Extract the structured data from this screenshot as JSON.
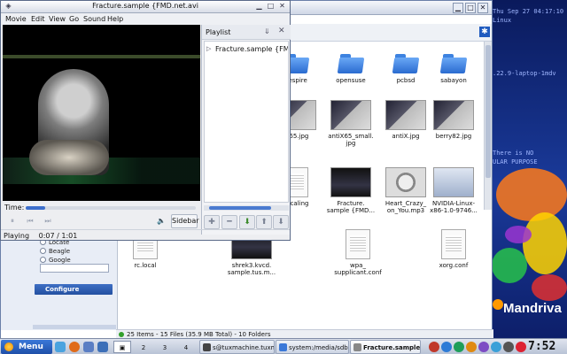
{
  "desktop": {
    "info_text": "Thu Sep 27 04:17:10\nLinux\n\n\n\n\n\n.22.9-laptop-1mdv\n\n\n\n\n\n\n\n\nThere is NO\nULAR PURPOSE",
    "logo_text": "Mandriva"
  },
  "file_manager": {
    "files": [
      {
        "name": "eespire",
        "kind": "folder"
      },
      {
        "name": "opensuse",
        "kind": "folder"
      },
      {
        "name": "pcbsd",
        "kind": "folder"
      },
      {
        "name": "sabayon",
        "kind": "folder"
      },
      {
        "name": "iX65.jpg",
        "kind": "image"
      },
      {
        "name": "antiX65_small.\njpg",
        "kind": "image"
      },
      {
        "name": "antiX.jpg",
        "kind": "image"
      },
      {
        "name": "berry82.jpg",
        "kind": "image"
      },
      {
        "name": "uscaling",
        "kind": "doc"
      },
      {
        "name": "Fracture.\nsample {FMD...",
        "kind": "video"
      },
      {
        "name": "Heart_Crazy_\non_You.mp3",
        "kind": "audio"
      },
      {
        "name": "NVIDIA-Linux-\nx86-1.0-9746...",
        "kind": "package"
      },
      {
        "name": "rc.local",
        "kind": "doc"
      },
      {
        "name": "shrek3.kvcd.\nsample.tus.m...",
        "kind": "video"
      },
      {
        "name": "wpa_\nsupplicant.conf",
        "kind": "doc"
      },
      {
        "name": "xorg.conf",
        "kind": "doc"
      }
    ],
    "sidebar": {
      "radio_options": [
        "Locate",
        "Beagle",
        "Google"
      ],
      "configure_label": "Configure"
    },
    "status": "25 Items - 15 Files (35.9 MB Total) - 10 Folders"
  },
  "player": {
    "title": "Fracture.sample {FMD.net.avi",
    "menu": [
      "Movie",
      "Edit",
      "View",
      "Go",
      "Sound",
      "Help"
    ],
    "playlist_title": "Playlist",
    "playlist_items": [
      "Fracture.sample {FMD.net.avi"
    ],
    "time_label": "Time:",
    "sidebar_label": "Sidebar",
    "status_state": "Playing",
    "status_time": "0:07 / 1:01",
    "progress_fraction": 0.115
  },
  "taskbar": {
    "menu_label": "Menu",
    "desktops": [
      "2",
      "3",
      "4"
    ],
    "tasks": [
      "s@tuxmachine.tuxm",
      "system:/media/sdb1",
      "Fracture.sample"
    ],
    "clock": "7:52"
  }
}
